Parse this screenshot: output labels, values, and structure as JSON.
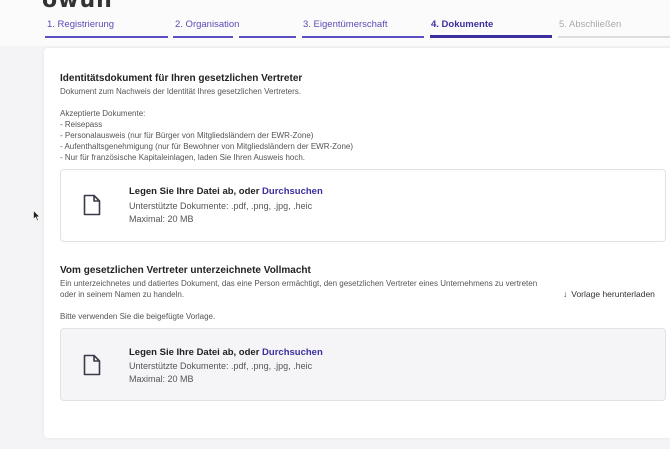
{
  "header": {
    "logo_partial": "owun"
  },
  "steps": [
    {
      "label": "1. Registrierung",
      "state": "done"
    },
    {
      "label": "2. Organisation",
      "state": "done"
    },
    {
      "label": "3. Eigentümerschaft",
      "state": "done"
    },
    {
      "label": "4. Dokumente",
      "state": "current"
    },
    {
      "label": "5. Abschließen",
      "state": "future"
    }
  ],
  "identity": {
    "title": "Identitätsdokument für Ihren gesetzlichen Vertreter",
    "description": "Dokument zum Nachweis der Identität Ihres gesetzlichen Vertreters.",
    "accepted_heading": "Akzeptierte Dokumente:",
    "accepted": [
      "- Reisepass",
      "- Personalausweis (nur für Bürger von Mitgliedsländern der EWR-Zone)",
      "- Aufenthaltsgenehmigung (nur für Bewohner von Mitgliedsländern der EWR-Zone)",
      "- Nur für französische Kapitaleinlagen, laden Sie Ihren Ausweis hoch."
    ],
    "drop": {
      "title": "Legen Sie Ihre Datei ab, oder",
      "link": "Durchsuchen",
      "formats": "Unterstützte Dokumente: .pdf, .png, .jpg, .heic",
      "max": "Maximal: 20 MB",
      "icon": "file-icon"
    }
  },
  "proxy": {
    "title": "Vom gesetzlichen Vertreter unterzeichnete Vollmacht",
    "description_line1": "Ein unterzeichnetes und datiertes Dokument, das eine Person ermächtigt, den gesetzlichen Vertreter eines Unternehmens zu vertreten",
    "description_line2": "oder in seinem Namen zu handeln.",
    "download_label": "Vorlage herunterladen",
    "template_hint": "Bitte verwenden Sie die beigefügte Vorlage.",
    "drop": {
      "title": "Legen Sie Ihre Datei ab, oder",
      "link": "Durchsuchen",
      "formats": "Unterstützte Dokumente: .pdf, .png, .jpg, .heic",
      "max": "Maximal: 20 MB",
      "icon": "file-icon"
    }
  },
  "colors": {
    "accent": "#3b2fa0",
    "step_done": "#5b4fc4",
    "step_future": "#dddddd"
  }
}
